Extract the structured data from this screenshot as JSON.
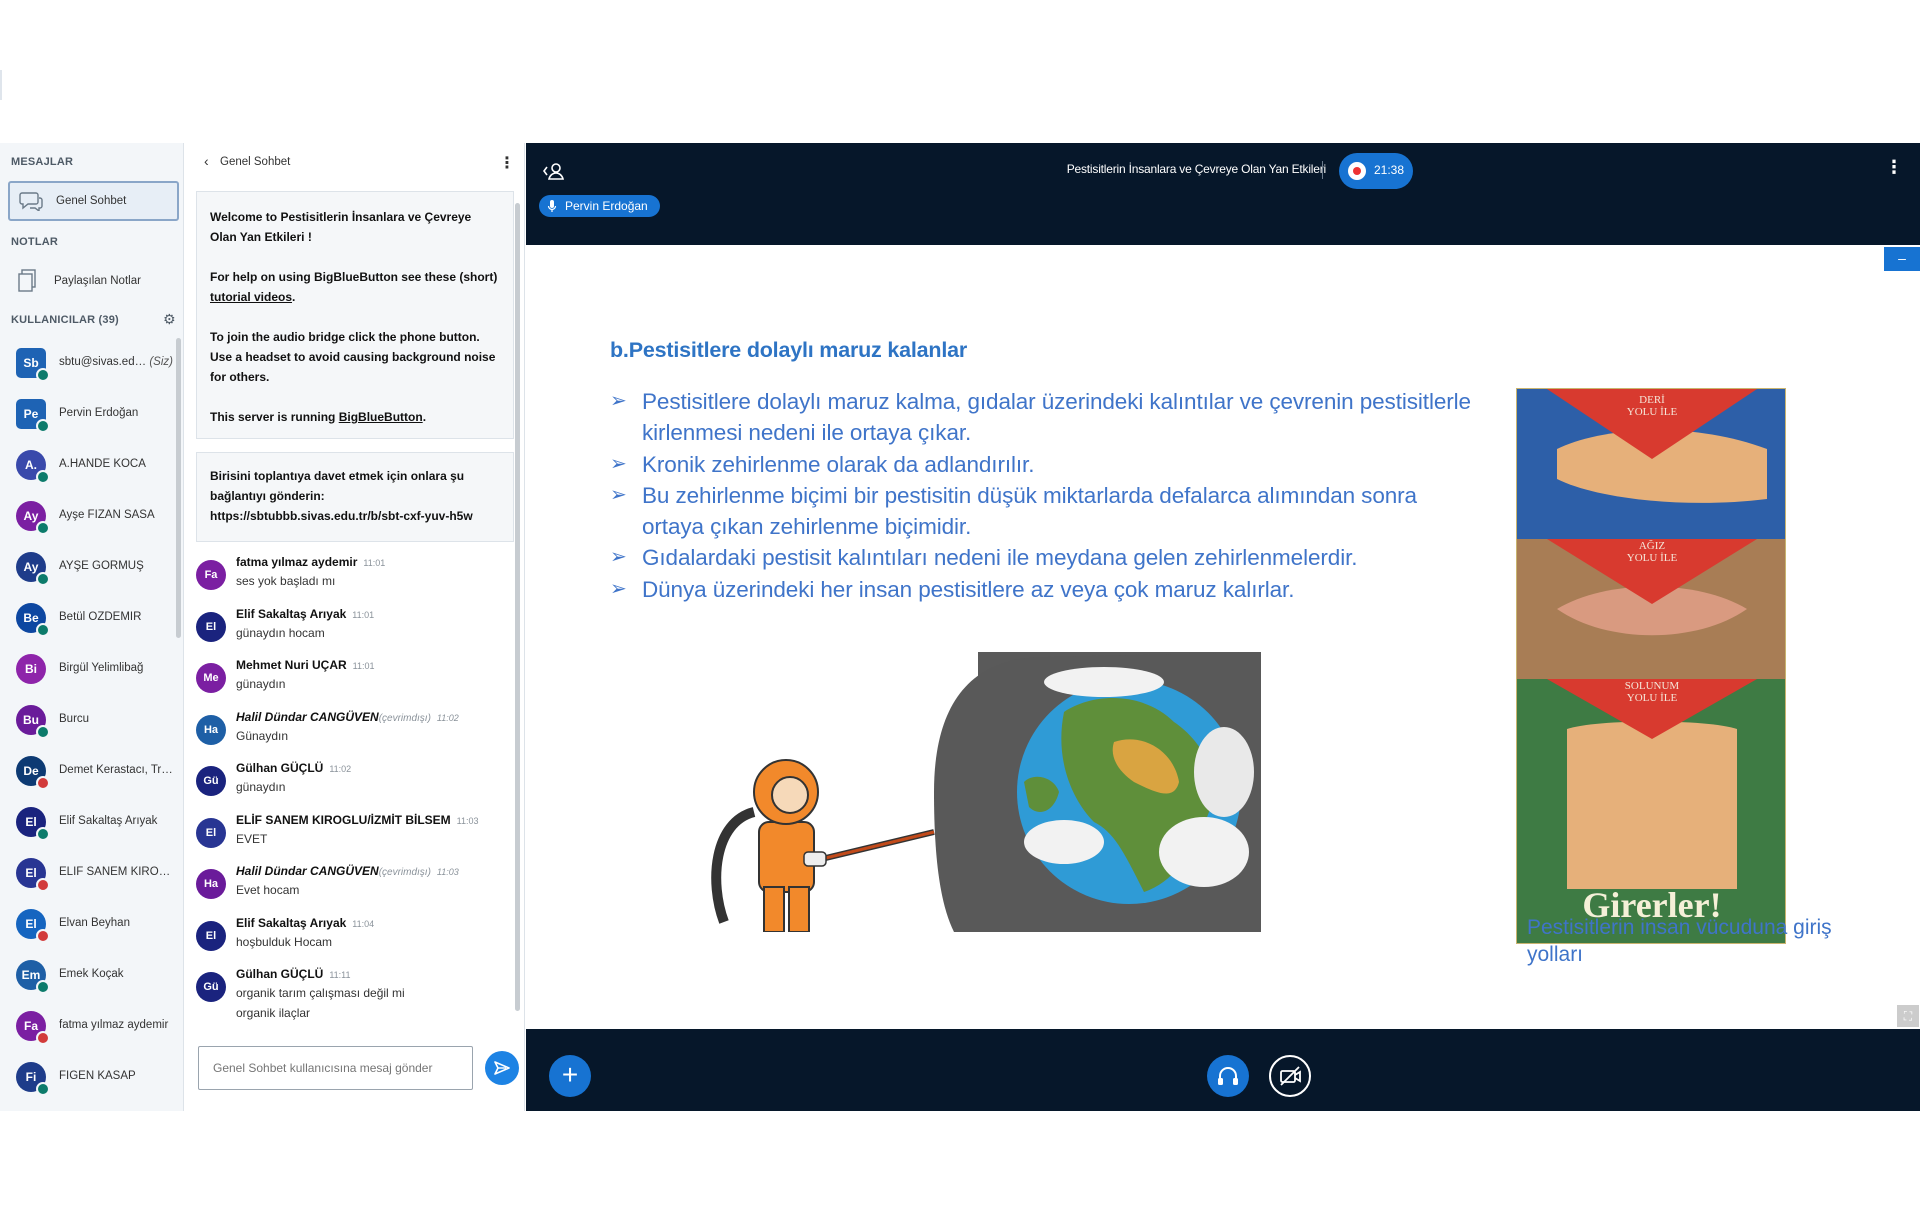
{
  "sidebar": {
    "messages_title": "MESAJLAR",
    "public_chat_label": "Genel Sohbet",
    "notes_title": "NOTLAR",
    "shared_notes_label": "Paylaşılan Notlar",
    "users_title": "KULLANICILAR (39)",
    "users": [
      {
        "initials": "Sb",
        "name": "sbtu@sivas.ed…",
        "you": "(Siz)",
        "color": "#1e63b4",
        "badge": "#0c7b6b",
        "square": true
      },
      {
        "initials": "Pe",
        "name": "Pervin Erdoğan",
        "color": "#1e63b4",
        "badge": "#0c7b6b",
        "square": true
      },
      {
        "initials": "A.",
        "name": "A.HANDE KOCA",
        "color": "#3949ab",
        "badge": "#0c7b6b"
      },
      {
        "initials": "Ay",
        "name": "Ayşe FİZAN SASA",
        "color": "#7b1fa2",
        "badge": "#0c7b6b"
      },
      {
        "initials": "Ay",
        "name": "AYŞE GÖRMÜŞ",
        "color": "#1e3c8a",
        "badge": "#0c7b6b"
      },
      {
        "initials": "Be",
        "name": "Betül ÖZDEMİR",
        "color": "#0d47a1",
        "badge": "#0c7b6b"
      },
      {
        "initials": "Bi",
        "name": "Birgül Yelimlibağ",
        "color": "#8e24aa",
        "badge": ""
      },
      {
        "initials": "Bu",
        "name": "Burcu",
        "color": "#6a1b9a",
        "badge": "#0c7b6b"
      },
      {
        "initials": "De",
        "name": "Demet Kerastacı, Tr…",
        "color": "#0d3a73",
        "badge": "#d23b3b"
      },
      {
        "initials": "El",
        "name": "Elif Sakaltaş Arıyak",
        "color": "#1a237e",
        "badge": "#0c7b6b"
      },
      {
        "initials": "El",
        "name": "ELİF SANEM KIROG…",
        "color": "#283593",
        "badge": "#d23b3b"
      },
      {
        "initials": "El",
        "name": "Elvan Beyhan",
        "color": "#1565c0",
        "badge": "#d23b3b"
      },
      {
        "initials": "Em",
        "name": "Emek Koçak",
        "color": "#1e5fa6",
        "badge": "#0c7b6b"
      },
      {
        "initials": "Fa",
        "name": "fatma yılmaz aydemir",
        "color": "#7b1fa2",
        "badge": "#d23b3b"
      },
      {
        "initials": "Fi",
        "name": "FİGEN KASAP",
        "color": "#1e3c8a",
        "badge": "#0c7b6b"
      }
    ]
  },
  "chat": {
    "title": "Genel Sohbet",
    "welcome": {
      "line1": "Welcome to Pestisitlerin İnsanlara ve Çevreye Olan Yan Etkileri !",
      "help_pre": "For help on using BigBlueButton see these (short) ",
      "help_link": "tutorial videos",
      "help_post": ".",
      "audio": "To join the audio bridge click the phone button. Use a headset to avoid causing background noise for others.",
      "server_pre": "This server is running ",
      "server_link": "BigBlueButton",
      "server_post": "."
    },
    "invite": "Birisini toplantıya davet etmek için onlara şu bağlantıyı gönderin: https://sbtubbb.sivas.edu.tr/b/sbt-cxf-yuv-h5w",
    "messages": [
      {
        "initials": "Fa",
        "color": "#7b1fa2",
        "name": "fatma yılmaz aydemir",
        "offline": "",
        "time": "11:01",
        "text": "ses yok başladı mı",
        "text2": ""
      },
      {
        "initials": "El",
        "color": "#1a237e",
        "name": "Elif Sakaltaş Arıyak",
        "offline": "",
        "time": "11:01",
        "text": "günaydın hocam",
        "text2": ""
      },
      {
        "initials": "Me",
        "color": "#7b1fa2",
        "name": "Mehmet Nuri UÇAR",
        "offline": "",
        "time": "11:01",
        "text": "günaydın",
        "text2": ""
      },
      {
        "initials": "Ha",
        "color": "#1e5fa6",
        "name": "Halil Dündar CANGÜVEN",
        "offline": "(çevrimdışı)",
        "time": "11:02",
        "text": "Günaydın",
        "text2": ""
      },
      {
        "initials": "Gü",
        "color": "#1a237e",
        "name": "Gülhan GÜÇLÜ",
        "offline": "",
        "time": "11:02",
        "text": "günaydın",
        "text2": ""
      },
      {
        "initials": "El",
        "color": "#283593",
        "name": "ELİF SANEM KIROGLU/İZMİT BİLSEM",
        "offline": "",
        "time": "11:03",
        "text": "EVET",
        "text2": ""
      },
      {
        "initials": "Ha",
        "color": "#6a1b9a",
        "name": "Halil Dündar CANGÜVEN",
        "offline": "(çevrimdışı)",
        "time": "11:03",
        "text": "Evet hocam",
        "text2": ""
      },
      {
        "initials": "El",
        "color": "#1a237e",
        "name": "Elif Sakaltaş Arıyak",
        "offline": "",
        "time": "11:04",
        "text": "hoşbulduk Hocam",
        "text2": ""
      },
      {
        "initials": "Gü",
        "color": "#1a237e",
        "name": "Gülhan GÜÇLÜ",
        "offline": "",
        "time": "11:11",
        "text": "organik tarım çalışması değil mi",
        "text2": "organik ilaçlar"
      }
    ],
    "input_placeholder": "Genel Sohbet kullanıcısına mesaj gönder"
  },
  "presentation": {
    "meeting_title": "Pestisitlerin İnsanlara ve Çevreye Olan Yan Etkileri",
    "recording_time": "21:38",
    "talker": "Pervin Erdoğan",
    "slide": {
      "heading": "b.Pestisitlere dolaylı maruz kalanlar",
      "bullets": [
        "Pestisitlere dolaylı maruz kalma, gıdalar üzerindeki kalıntılar ve çevrenin pestisitlerle kirlenmesi nedeni ile ortaya çıkar.",
        "Kronik zehirlenme olarak da adlandırılır.",
        "Bu zehirlenme biçimi bir pestisitin düşük miktarlarda defalarca alımından sonra ortaya çıkan zehirlenme biçimidir.",
        "Gıdalardaki pestisit kalıntıları nedeni ile meydana gelen zehirlenmelerdir.",
        "Dünya üzerindeki her insan pestisitlere az veya çok maruz kalırlar."
      ],
      "poster": {
        "label1": "DERİ\nYOLU İLE",
        "label2": "AĞIZ\nYOLU İLE",
        "label3": "SOLUNUM\nYOLU İLE",
        "footer": "Girerler!"
      },
      "caption": "Pestisitlerin insan vücuduna giriş yolları"
    }
  },
  "colors": {
    "accent": "#1773d2",
    "dark_bg": "#06172a",
    "slide_text": "#3f74c9"
  }
}
